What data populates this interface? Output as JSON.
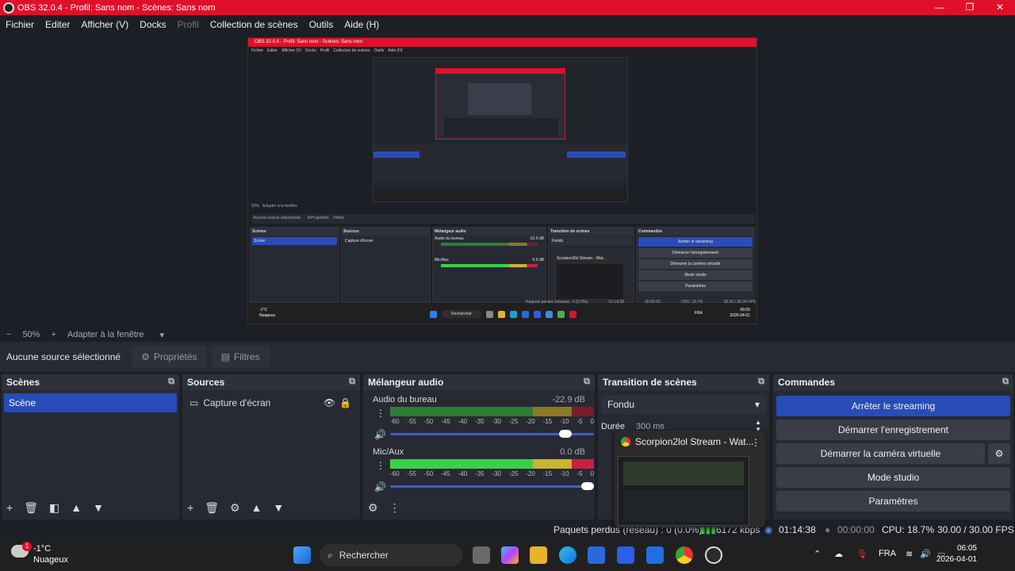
{
  "window": {
    "title": "OBS 32.0.4 - Profil: Sans nom - Scènes: Sans nom",
    "minimize": "—",
    "maximize": "❐",
    "close": "✕"
  },
  "menu": [
    "Fichier",
    "Editer",
    "Afficher (V)",
    "Docks",
    "Profil",
    "Collection de scènes",
    "Outils",
    "Aide (H)"
  ],
  "nested": {
    "title": "OBS 32.0.4 - Profil: Sans nom - Scènes: Sans nom",
    "zoom": "50%",
    "fit": "Adapter à la fenêtre",
    "no_source": "Aucune source sélectionné",
    "props": "Propriétés",
    "filters": "Filtres",
    "scenes": "Scènes",
    "scene": "Scène",
    "sources": "Sources",
    "capture": "Capture d'écran",
    "mixer": "Mélangeur audio",
    "desktop": "Audio du bureau",
    "desktop_db": "-22.9 dB",
    "mic": "Mic/Aux",
    "mic_db": "0.0 dB",
    "transition": "Transition de scènes",
    "fade": "Fondu",
    "commands": "Commandes",
    "cmd": [
      "Arrêter le streaming",
      "Démarrer l'enregistrement",
      "Démarrer la caméra virtuelle",
      "Mode studio",
      "Paramètres"
    ],
    "popup": "Scorpion2lol Stream - Wat...",
    "status_time": "01:14:38",
    "status_rec": "00:00:00",
    "cpu": "CPU: 18.7%",
    "fps": "30.00 / 30.00 FPS",
    "dropped": "Paquets perdus (réseau) : 0 (0.0%)",
    "temp": "-1°C",
    "weather": "Nuageux",
    "search": "Rechercher",
    "lang": "FRA",
    "clock": "06:05",
    "date": "2026-04-01"
  },
  "zoombar": {
    "minus": "−",
    "zoom": "50%",
    "plus": "+",
    "fit": "Adapter à la fenêtre"
  },
  "sourcebar": {
    "none": "Aucune source sélectionné",
    "properties": "Propriétés",
    "filters": "Filtres"
  },
  "scenes": {
    "title": "Scènes",
    "items": [
      "Scène"
    ]
  },
  "sources": {
    "title": "Sources",
    "items": [
      "Capture d'écran"
    ]
  },
  "mixer": {
    "title": "Mélangeur audio",
    "tracks": [
      {
        "name": "Audio du bureau",
        "db": "-22.9 dB",
        "level": 0.89
      },
      {
        "name": "Mic/Aux",
        "db": "0.0 dB",
        "level": 1.0
      }
    ],
    "ticks": [
      "-60",
      "-55",
      "-50",
      "-45",
      "-40",
      "-35",
      "-30",
      "-25",
      "-20",
      "-15",
      "-10",
      "-5",
      "0"
    ]
  },
  "transition": {
    "title": "Transition de scènes",
    "selected": "Fondu",
    "duration_label": "Durée",
    "duration": "300 ms"
  },
  "commands": {
    "title": "Commandes",
    "stop_stream": "Arrêter le streaming",
    "start_rec": "Démarrer l'enregistrement",
    "start_vcam": "Démarrer la caméra virtuelle",
    "studio": "Mode studio",
    "settings": "Paramètres"
  },
  "popup": {
    "title": "Scorpion2lol Stream - Wat..."
  },
  "status": {
    "dropped": "Paquets perdus (réseau) : 0 (0.0%)",
    "bitrate": "6172 kbps",
    "stream_time": "01:14:38",
    "rec_time": "00:00:00",
    "cpu": "CPU: 18.7%",
    "fps": "30.00 / 30.00 FPS"
  },
  "taskbar": {
    "temp": "-1°C",
    "weather": "Nuageux",
    "badge": "1",
    "search": "Rechercher",
    "lang": "FRA",
    "time": "06:05",
    "date": "2026-04-01"
  },
  "colors": {
    "accent": "#284cb8",
    "titlebar": "#e0102a",
    "bg": "#1d1f26",
    "dock": "#272a33"
  }
}
